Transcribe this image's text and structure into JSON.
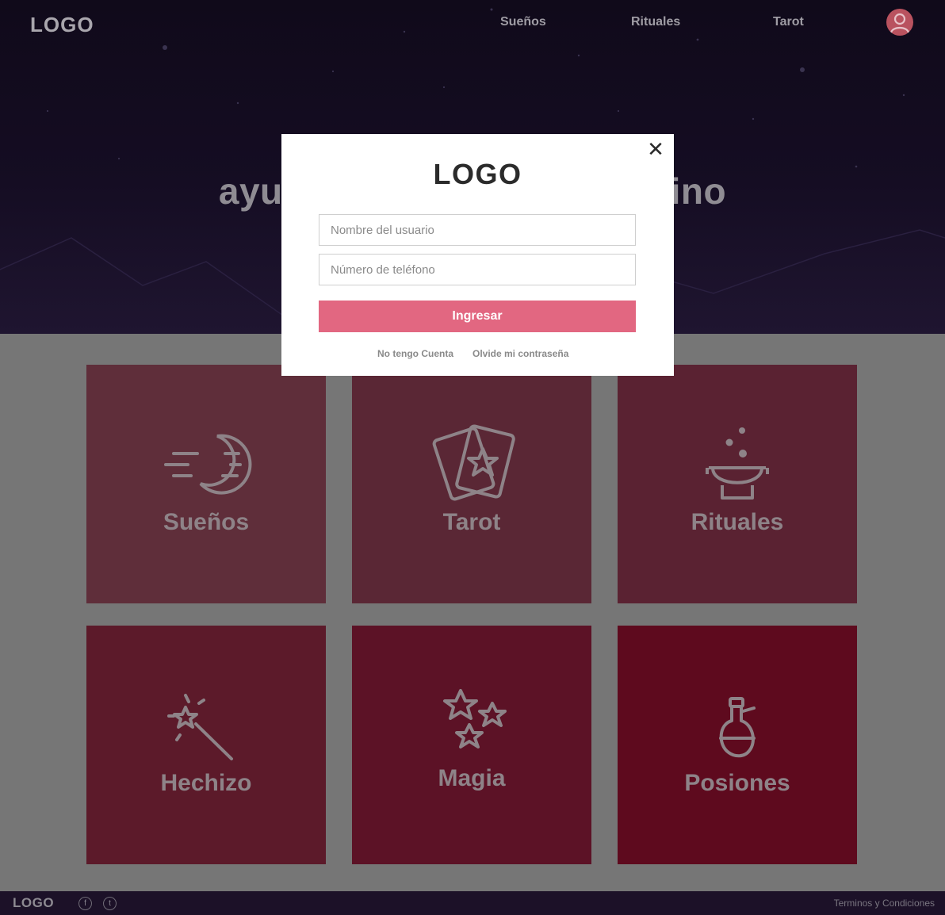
{
  "header": {
    "logo": "LOGO",
    "nav": [
      "Sueños",
      "Rituales",
      "Tarot"
    ],
    "hero_title": "ayuda a descubrir tu destino"
  },
  "tiles": [
    {
      "label": "Sueños",
      "icon": "moon-icon"
    },
    {
      "label": "Tarot",
      "icon": "tarot-cards-icon"
    },
    {
      "label": "Rituales",
      "icon": "cauldron-icon"
    },
    {
      "label": "Hechizo",
      "icon": "magic-wand-icon"
    },
    {
      "label": "Magia",
      "icon": "stars-icon"
    },
    {
      "label": "Posiones",
      "icon": "potion-icon"
    }
  ],
  "footer": {
    "logo": "LOGO",
    "social": [
      "f",
      "t"
    ],
    "terms": "Terminos y Condiciones"
  },
  "modal": {
    "logo": "LOGO",
    "close": "✕",
    "username_placeholder": "Nombre del usuario",
    "phone_placeholder": "Número de teléfono",
    "submit_label": "Ingresar",
    "no_account_link": "No tengo Cuenta",
    "forgot_link": "Olvide mi contraseña"
  },
  "colors": {
    "accent": "#e26781",
    "hero_bg": "#150d23",
    "footer_bg": "#1c1128"
  }
}
